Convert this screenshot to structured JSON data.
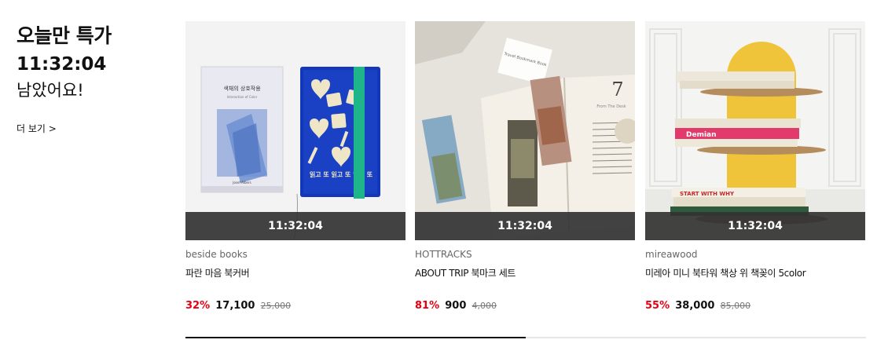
{
  "deal": {
    "title": "오늘만 특가",
    "timer": "11:32:04",
    "remaining": "남았어요!",
    "more_label": "더 보기 >"
  },
  "products": [
    {
      "brand": "beside books",
      "name": "파란 마음 북커버",
      "timer": "11:32:04",
      "discount": "32%",
      "price": "17,100",
      "original_price": "25,000",
      "image_icon": "book-cover-product-image",
      "book_title": "색채의 상호작용",
      "book_subtitle": "Josef Albers",
      "cover_text": "읽고 또 읽고 또 읽고 또"
    },
    {
      "brand": "HOTTRACKS",
      "name": "ABOUT TRIP 북마크 세트",
      "timer": "11:32:04",
      "discount": "81%",
      "price": "900",
      "original_price": "4,000",
      "image_icon": "bookmark-set-product-image",
      "page_number": "7",
      "card_text": "Travel Bookmark Book",
      "chapter_text": "From The Desk"
    },
    {
      "brand": "mireawood",
      "name": "미레아 미니 북타워 책상 위 책꽂이 5color",
      "timer": "11:32:04",
      "discount": "55%",
      "price": "38,000",
      "original_price": "85,000",
      "image_icon": "book-tower-product-image",
      "spine_texts": [
        "Demian",
        "START WITH WHY"
      ]
    }
  ],
  "carousel": {
    "progress": 0.5
  }
}
